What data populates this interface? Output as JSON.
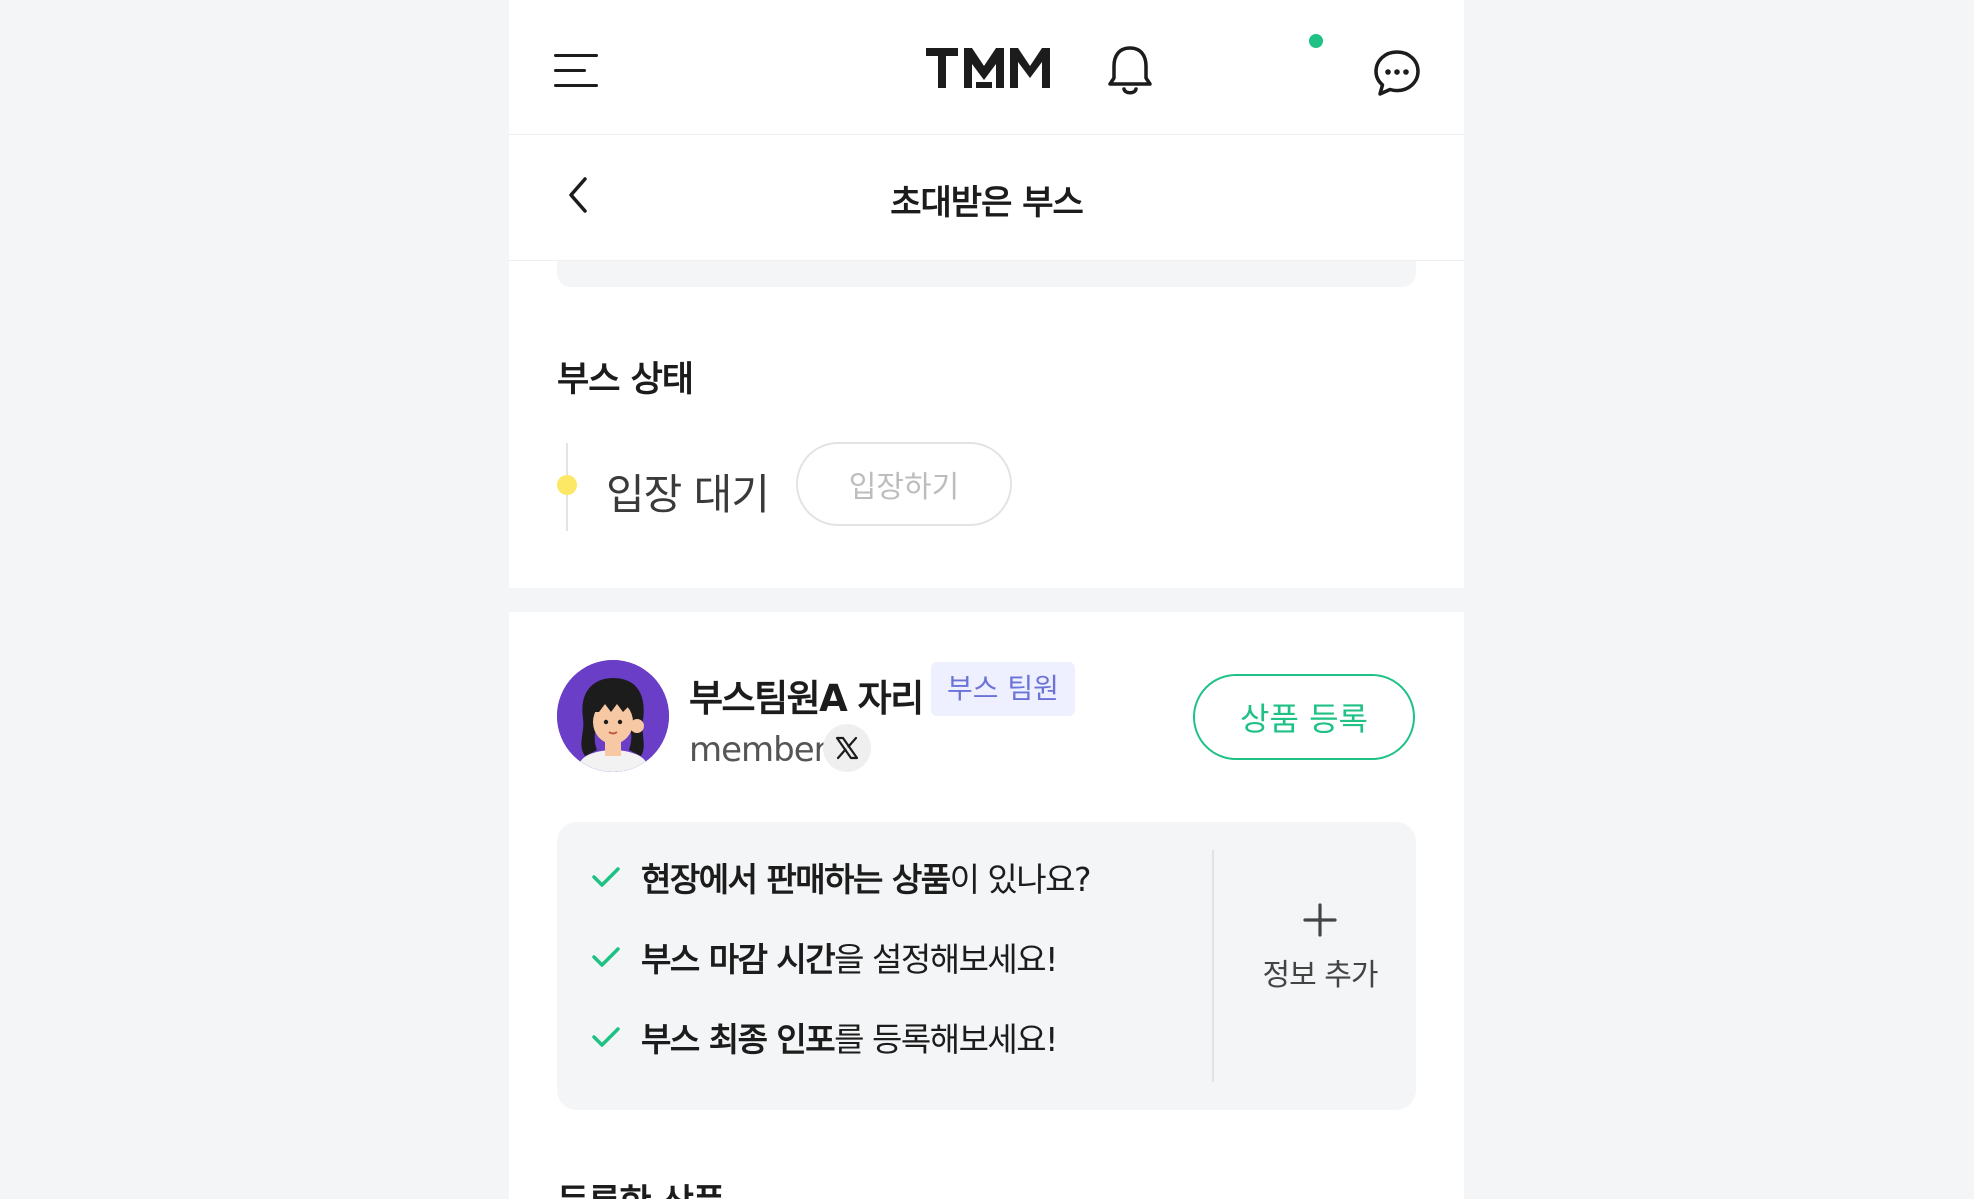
{
  "app": {
    "logo_text": "TMM"
  },
  "header": {
    "title": "초대받은 부스",
    "notification_dot_color": "#1fc184"
  },
  "booth_status": {
    "section_title": "부스 상태",
    "status_label": "입장 대기",
    "status_color": "#fde865",
    "enter_button": "입장하기"
  },
  "member": {
    "name": "부스팀원A 자리",
    "role_badge": "부스 팀원",
    "handle": "member",
    "social_icon": "x-logo-icon",
    "product_register_button": "상품 등록"
  },
  "checklist": {
    "items": [
      {
        "strong": "현장에서 판매하는 상품",
        "rest": "이 있나요?"
      },
      {
        "strong": "부스 마감 시간",
        "rest": "을 설정해보세요!"
      },
      {
        "strong": "부스 최종 인포",
        "rest": "를 등록해보세요!"
      }
    ],
    "add_info_label": "정보 추가",
    "check_color": "#1fc184"
  },
  "registered_products": {
    "section_title": "등록한 상품"
  },
  "colors": {
    "accent_green": "#1fc184",
    "badge_bg": "#eef0ff",
    "badge_text": "#6b73d8"
  }
}
